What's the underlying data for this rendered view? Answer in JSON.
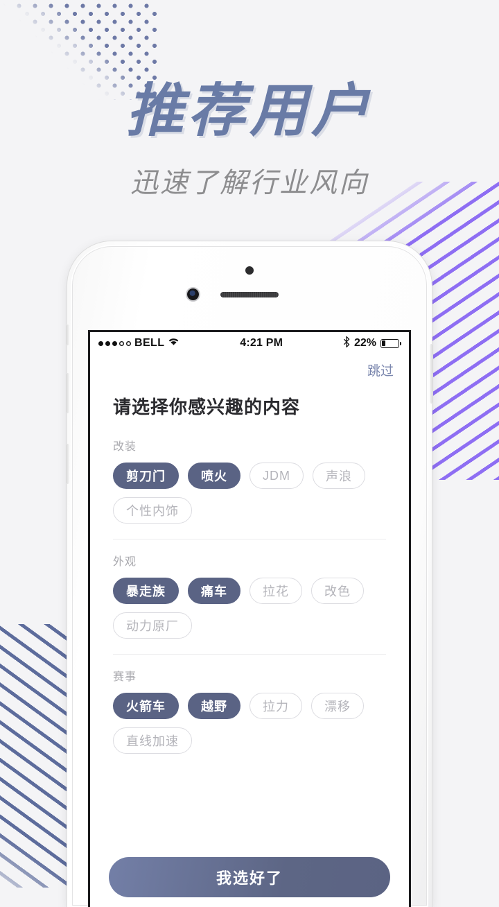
{
  "hero": {
    "title": "推荐用户",
    "subtitle": "迅速了解行业风向",
    "title_color": "#697ba6",
    "subtitle_color": "#8d8d8f"
  },
  "decor": {
    "dot_color": "#6d79a6",
    "stripe_right_color": "#8e6ef3",
    "stripe_left_color": "#5d6c9c",
    "background_color": "#f4f4f6"
  },
  "phone": {
    "statusbar": {
      "signal_dots_filled": 3,
      "signal_dots_empty": 2,
      "carrier": "BELL",
      "wifi_icon": "wifi-icon",
      "time": "4:21 PM",
      "bluetooth_icon": "bluetooth-icon",
      "battery_percent": "22%",
      "battery_level": 22
    },
    "skip_label": "跳过",
    "page_title": "请选择你感兴趣的内容",
    "selected_tag_color": "#5a6384",
    "unselected_tag_border": "#dcdce1",
    "unselected_tag_text": "#b4b4ba",
    "sections": [
      {
        "label": "改装",
        "tags": [
          {
            "label": "剪刀门",
            "selected": true
          },
          {
            "label": "喷火",
            "selected": true
          },
          {
            "label": "JDM",
            "selected": false
          },
          {
            "label": "声浪",
            "selected": false
          },
          {
            "label": "个性内饰",
            "selected": false
          }
        ]
      },
      {
        "label": "外观",
        "tags": [
          {
            "label": "暴走族",
            "selected": true
          },
          {
            "label": "痛车",
            "selected": true
          },
          {
            "label": "拉花",
            "selected": false
          },
          {
            "label": "改色",
            "selected": false
          },
          {
            "label": "动力原厂",
            "selected": false
          }
        ]
      },
      {
        "label": "赛事",
        "tags": [
          {
            "label": "火箭车",
            "selected": true
          },
          {
            "label": "越野",
            "selected": true
          },
          {
            "label": "拉力",
            "selected": false
          },
          {
            "label": "漂移",
            "selected": false
          },
          {
            "label": "直线加速",
            "selected": false
          }
        ]
      }
    ],
    "cta_label": "我选好了"
  }
}
